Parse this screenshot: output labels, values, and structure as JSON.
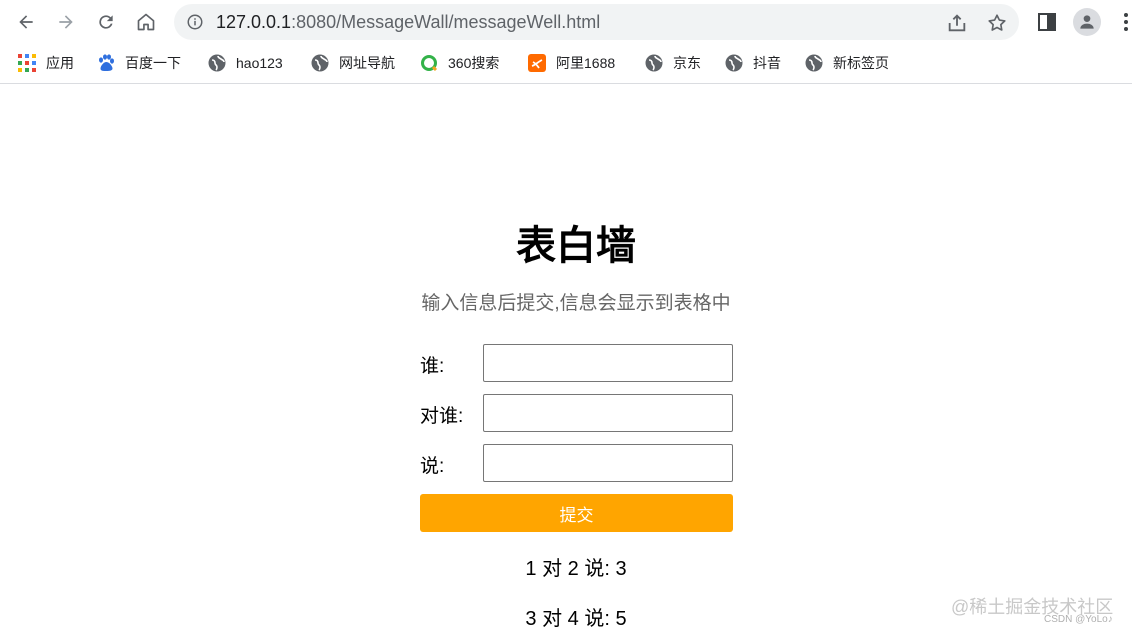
{
  "browser": {
    "url_host": "127.0.0.1",
    "url_path": ":8080/MessageWall/messageWell.html",
    "bookmarks": [
      {
        "label": "应用",
        "icon": "apps-grid-icon"
      },
      {
        "label": "百度一下",
        "icon": "baidu-paw-icon"
      },
      {
        "label": "hao123",
        "icon": "globe-icon"
      },
      {
        "label": "网址导航",
        "icon": "globe-icon"
      },
      {
        "label": "360搜索",
        "icon": "360-search-icon"
      },
      {
        "label": "阿里1688",
        "icon": "ali1688-icon"
      },
      {
        "label": "京东",
        "icon": "globe-icon"
      },
      {
        "label": "抖音",
        "icon": "globe-icon"
      },
      {
        "label": "新标签页",
        "icon": "globe-icon"
      }
    ]
  },
  "page": {
    "title": "表白墙",
    "subtitle": "输入信息后提交,信息会显示到表格中",
    "form": {
      "from_label": "谁:",
      "to_label": "对谁:",
      "message_label": "说:",
      "from_value": "",
      "to_value": "",
      "message_value": "",
      "submit_label": "提交"
    },
    "messages": [
      "1 对 2 说: 3",
      "3 对 4 说: 5"
    ],
    "accent_color": "#ffa500"
  },
  "watermark": {
    "main": "@稀土掘金技术社区",
    "small": "CSDN @YoLo♪"
  }
}
